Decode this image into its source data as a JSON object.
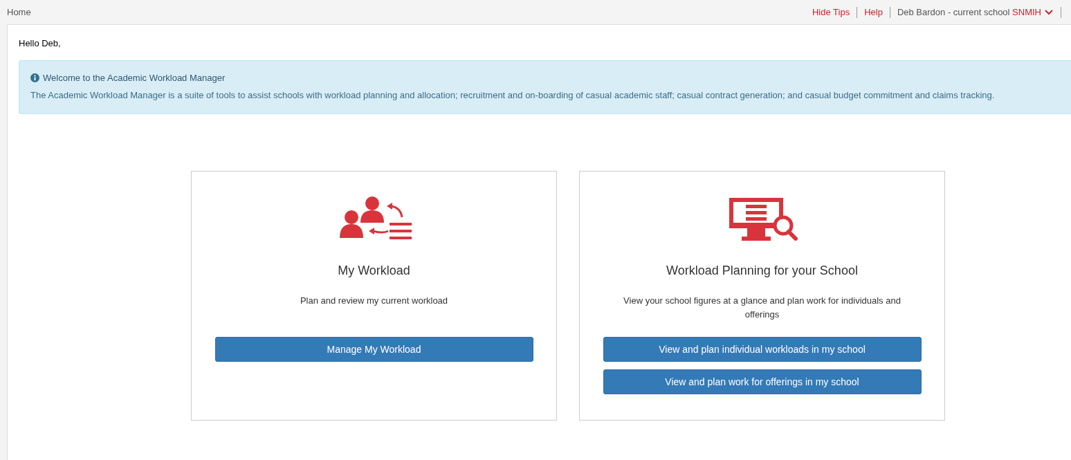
{
  "breadcrumb": "Home",
  "top_links": [
    {
      "label": "Hide Tips",
      "kind": "link"
    },
    {
      "label": "Help",
      "kind": "link"
    },
    {
      "label": "Deb Bardon - current school ",
      "kind": "user",
      "school": "SNMIH"
    }
  ],
  "greeting": "Hello Deb,",
  "alert": {
    "title": "Welcome to the Academic Workload Manager",
    "text": "The Academic Workload Manager is a suite of tools to assist schools with workload planning and allocation; recruitment and on-boarding of casual academic staff; casual contract generation; and casual budget commitment and claims tracking."
  },
  "cards": [
    {
      "kind": "people",
      "title": "My Workload",
      "description": "Plan and review my current workload",
      "buttons": [
        "Manage My Workload"
      ]
    },
    {
      "kind": "monitor",
      "title": "Workload Planning for your School",
      "description": "View your school figures at a glance and plan work for individuals and offerings",
      "buttons": [
        "View and plan individual workloads in my school",
        "View and plan work for offerings in my school"
      ]
    }
  ]
}
